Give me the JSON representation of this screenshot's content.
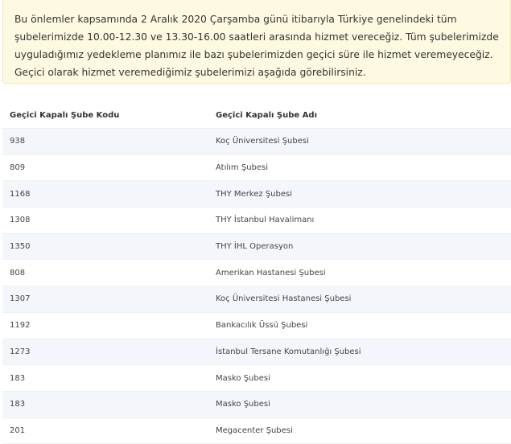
{
  "notice": {
    "text": "Bu önlemler kapsamında 2 Aralık 2020 Çarşamba günü itibarıyla Türkiye genelindeki tüm şubelerimizde 10.00-12.30 ve 13.30-16.00 saatleri arasında hizmet vereceğiz. Tüm şubelerimizde uyguladığımız yedekleme planımız ile bazı şubelerimizden geçici süre ile hizmet veremeyeceğiz. Geçici olarak hizmet veremediğimiz şubelerimizi aşağıda görebilirsiniz."
  },
  "table": {
    "headers": {
      "code": "Geçici Kapalı Şube Kodu",
      "name": "Geçici Kapalı Şube Adı"
    },
    "rows": [
      {
        "code": "938",
        "name": "Koç Üniversitesi Şubesi"
      },
      {
        "code": "809",
        "name": "Atılım Şubesi"
      },
      {
        "code": "1168",
        "name": "THY Merkez Şubesi"
      },
      {
        "code": "1308",
        "name": "THY İstanbul Havalimanı"
      },
      {
        "code": "1350",
        "name": "THY İHL Operasyon"
      },
      {
        "code": "808",
        "name": "Amerikan Hastanesi Şubesi"
      },
      {
        "code": "1307",
        "name": "Koç Üniversitesi Hastanesi Şubesi"
      },
      {
        "code": "1192",
        "name": "Bankacılık Üssü Şubesi"
      },
      {
        "code": "1273",
        "name": "İstanbul Tersane Komutanlığı Şubesi"
      },
      {
        "code": "183",
        "name": "Masko Şubesi"
      },
      {
        "code": "183",
        "name": "Masko Şubesi"
      },
      {
        "code": "201",
        "name": "Megacenter Şubesi"
      }
    ]
  }
}
